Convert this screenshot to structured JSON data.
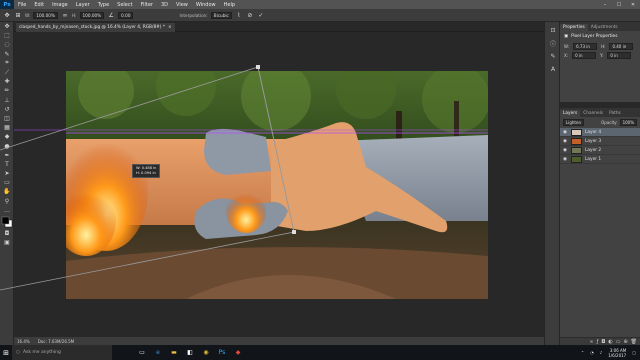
{
  "menubar": {
    "logo": "Ps",
    "items": [
      "File",
      "Edit",
      "Image",
      "Layer",
      "Type",
      "Select",
      "Filter",
      "3D",
      "View",
      "Window",
      "Help"
    ],
    "window_controls": {
      "minimize": "–",
      "maximize": "☐",
      "close": "✕"
    }
  },
  "options": {
    "w_label": "W:",
    "w_value": "100.00%",
    "h_label": "H:",
    "h_value": "100.00%",
    "angle_value": "0.00",
    "interpolation_label": "Interpolation:",
    "interpolation_value": "Bicubic",
    "cancel_icon": "⊘",
    "commit_icon": "✓"
  },
  "document": {
    "tab_title": "clasped_hands_by_mjnasen_stock.jpg @ 16.4% (Layer 4, RGB/8#) *",
    "tab_close": "×"
  },
  "canvas_tooltip": {
    "line1": "W: 0.488 in",
    "line2": "H: 0.094 in"
  },
  "status": {
    "zoom": "16.4%",
    "doc": "Doc: 7.03M/26.5M"
  },
  "properties": {
    "tabs": [
      "Properties",
      "Adjustments"
    ],
    "header": "Pixel Layer Properties",
    "w_label": "W:",
    "w_value": "6.73 in",
    "h_label": "H:",
    "h_value": "0.40 in",
    "x_label": "X:",
    "x_value": "0 in",
    "y_label": "Y:",
    "y_value": "0 in"
  },
  "layers": {
    "tabs": [
      "Layers",
      "Channels",
      "Paths"
    ],
    "blend_mode": "Lighten",
    "opacity_label": "Opacity:",
    "opacity_value": "100%",
    "list": [
      {
        "name": "Layer 4",
        "selected": true
      },
      {
        "name": "Layer 3",
        "selected": false
      },
      {
        "name": "Layer 2",
        "selected": false
      },
      {
        "name": "Layer 1",
        "selected": false
      }
    ]
  },
  "taskbar": {
    "search_placeholder": "Ask me anything",
    "time": "3:06 AM",
    "date": "1/6/2017"
  },
  "colors": {
    "accent": "#31a8ff",
    "guide": "#b24cff",
    "layer_selected": "#5b6671"
  }
}
